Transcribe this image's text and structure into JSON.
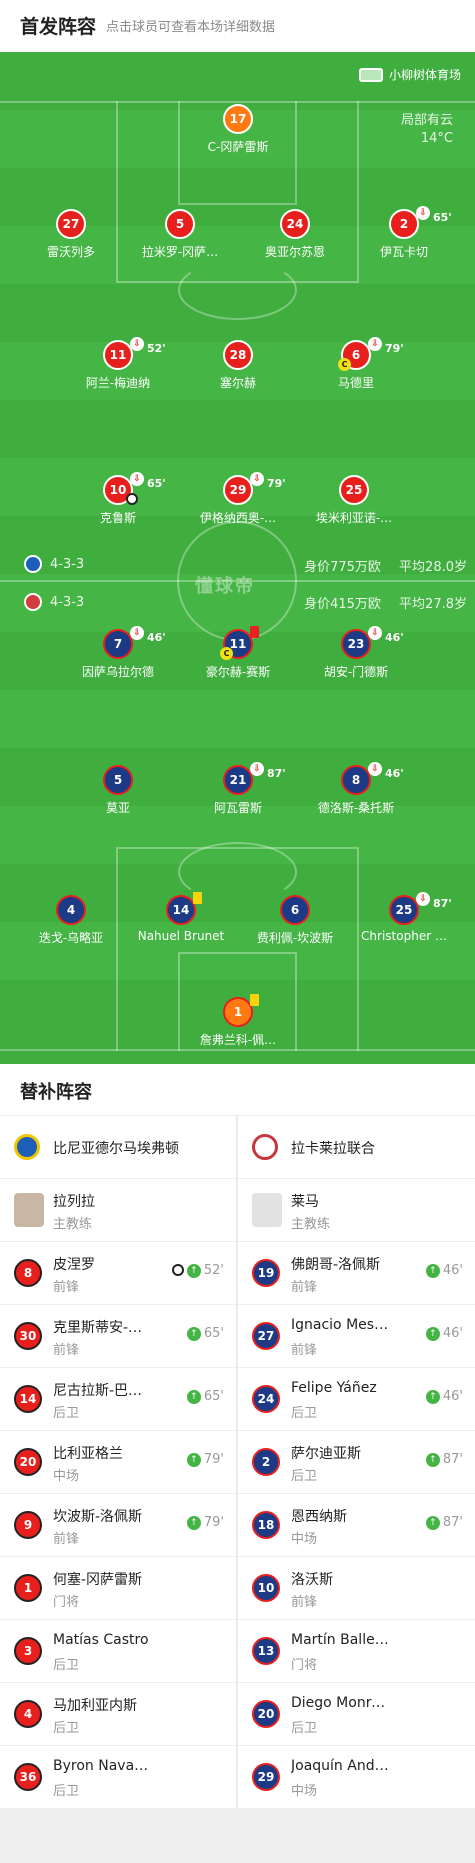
{
  "header": {
    "title": "首发阵容",
    "subtitle": "点击球员可查看本场详细数据"
  },
  "pitch": {
    "venue": "小柳树体育场",
    "weather_line1": "局部有云",
    "weather_line2": "14°C",
    "watermark": "懂球帝"
  },
  "home_team": {
    "formation": "4-3-3",
    "value": "身价775万欧",
    "avg_age": "平均28.0岁"
  },
  "away_team": {
    "formation": "4-3-3",
    "value": "身价415万欧",
    "avg_age": "平均27.8岁"
  },
  "home_players": [
    {
      "num": "17",
      "name": "C-冈萨雷斯",
      "gk": true
    },
    {
      "num": "27",
      "name": "雷沃列多"
    },
    {
      "num": "5",
      "name": "拉米罗-冈萨…"
    },
    {
      "num": "24",
      "name": "奥亚尔苏恩"
    },
    {
      "num": "2",
      "name": "伊瓦卡切",
      "sub": "65'"
    },
    {
      "num": "11",
      "name": "阿兰-梅迪纳",
      "sub": "52'"
    },
    {
      "num": "28",
      "name": "塞尔赫"
    },
    {
      "num": "6",
      "name": "马德里",
      "sub": "79'",
      "captain": "C"
    },
    {
      "num": "10",
      "name": "克鲁斯",
      "sub": "65'"
    },
    {
      "num": "29",
      "name": "伊格纳西奥-…",
      "sub": "79'"
    },
    {
      "num": "25",
      "name": "埃米利亚诺-…"
    }
  ],
  "away_players": [
    {
      "num": "7",
      "name": "因萨乌拉尔德",
      "sub": "46'"
    },
    {
      "num": "11",
      "name": "豪尔赫-赛斯",
      "captain": "C"
    },
    {
      "num": "23",
      "name": "胡安-门德斯",
      "sub": "46'"
    },
    {
      "num": "5",
      "name": "莫亚"
    },
    {
      "num": "21",
      "name": "阿瓦雷斯",
      "sub": "87'"
    },
    {
      "num": "8",
      "name": "德洛斯-桑托斯",
      "sub": "46'"
    },
    {
      "num": "4",
      "name": "迭戈-乌略亚"
    },
    {
      "num": "14",
      "name": "Nahuel Brunet"
    },
    {
      "num": "6",
      "name": "费利佩-坎波斯"
    },
    {
      "num": "25",
      "name": "Christopher …",
      "sub": "87'"
    },
    {
      "num": "1",
      "name": "詹弗兰科-佩…",
      "gk": true
    }
  ],
  "subs": {
    "title": "替补阵容",
    "left": {
      "team": "比尼亚德尔马埃弗顿",
      "coach": {
        "name": "拉列拉",
        "role": "主教练"
      },
      "players": [
        {
          "num": "8",
          "name": "皮涅罗",
          "pos": "前锋",
          "min": "52'"
        },
        {
          "num": "30",
          "name": "克里斯蒂安-…",
          "pos": "前锋",
          "min": "65'"
        },
        {
          "num": "14",
          "name": "尼古拉斯-巴…",
          "pos": "后卫",
          "min": "65'"
        },
        {
          "num": "20",
          "name": "比利亚格兰",
          "pos": "中场",
          "min": "79'"
        },
        {
          "num": "9",
          "name": "坎波斯-洛佩斯",
          "pos": "前锋",
          "min": "79'"
        },
        {
          "num": "1",
          "name": "何塞-冈萨雷斯",
          "pos": "门将",
          "min": ""
        },
        {
          "num": "3",
          "name": "Matías Castro",
          "pos": "后卫",
          "min": ""
        },
        {
          "num": "4",
          "name": "马加利亚内斯",
          "pos": "后卫",
          "min": ""
        },
        {
          "num": "36",
          "name": "Byron Navarro",
          "pos": "后卫",
          "min": ""
        }
      ]
    },
    "right": {
      "team": "拉卡莱拉联合",
      "coach": {
        "name": "莱马",
        "role": "主教练"
      },
      "players": [
        {
          "num": "19",
          "name": "佛朗哥-洛佩斯",
          "pos": "前锋",
          "min": "46'"
        },
        {
          "num": "27",
          "name": "Ignacio Mesías",
          "pos": "前锋",
          "min": "46'"
        },
        {
          "num": "24",
          "name": "Felipe Yáñez",
          "pos": "后卫",
          "min": "46'"
        },
        {
          "num": "2",
          "name": "萨尔迪亚斯",
          "pos": "后卫",
          "min": "87'"
        },
        {
          "num": "18",
          "name": "恩西纳斯",
          "pos": "中场",
          "min": "87'"
        },
        {
          "num": "10",
          "name": "洛沃斯",
          "pos": "前锋",
          "min": ""
        },
        {
          "num": "13",
          "name": "Martín Ballest…",
          "pos": "门将",
          "min": ""
        },
        {
          "num": "20",
          "name": "Diego Monreal",
          "pos": "后卫",
          "min": ""
        },
        {
          "num": "29",
          "name": "Joaquín Andr…",
          "pos": "中场",
          "min": ""
        }
      ]
    }
  }
}
